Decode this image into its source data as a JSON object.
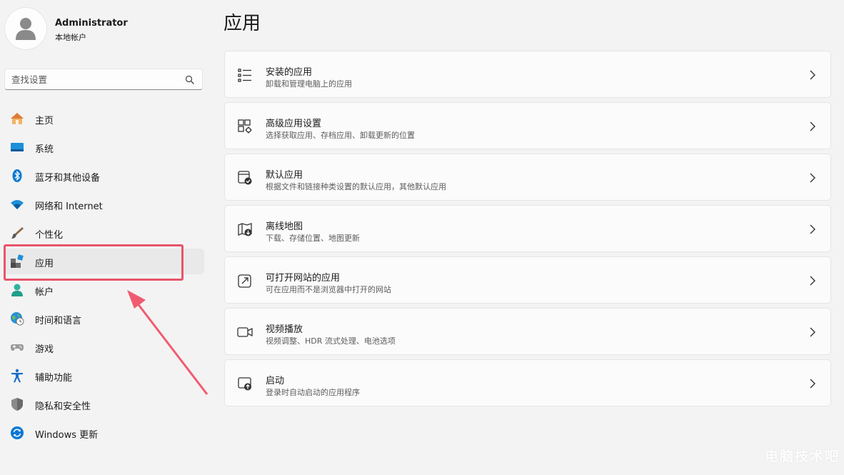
{
  "user": {
    "name": "Administrator",
    "account_type": "本地帐户"
  },
  "search": {
    "placeholder": "查找设置",
    "value": ""
  },
  "sidebar": {
    "items": [
      {
        "label": "主页",
        "icon": "home-icon"
      },
      {
        "label": "系统",
        "icon": "system-icon"
      },
      {
        "label": "蓝牙和其他设备",
        "icon": "bluetooth-icon"
      },
      {
        "label": "网络和 Internet",
        "icon": "wifi-icon"
      },
      {
        "label": "个性化",
        "icon": "brush-icon"
      },
      {
        "label": "应用",
        "icon": "apps-icon",
        "active": true
      },
      {
        "label": "帐户",
        "icon": "account-icon"
      },
      {
        "label": "时间和语言",
        "icon": "globe-clock-icon"
      },
      {
        "label": "游戏",
        "icon": "gamepad-icon"
      },
      {
        "label": "辅助功能",
        "icon": "accessibility-icon"
      },
      {
        "label": "隐私和安全性",
        "icon": "shield-icon"
      },
      {
        "label": "Windows 更新",
        "icon": "update-icon"
      }
    ]
  },
  "main": {
    "title": "应用",
    "cards": [
      {
        "title": "安装的应用",
        "subtitle": "卸载和管理电脑上的应用",
        "icon": "list-icon"
      },
      {
        "title": "高级应用设置",
        "subtitle": "选择获取应用、存档应用、卸载更新的位置",
        "icon": "app-settings-icon"
      },
      {
        "title": "默认应用",
        "subtitle": "根据文件和链接种类设置的默认应用，其他默认应用",
        "icon": "default-apps-icon"
      },
      {
        "title": "离线地图",
        "subtitle": "下载、存储位置、地图更新",
        "icon": "offline-map-icon"
      },
      {
        "title": "可打开网站的应用",
        "subtitle": "可在应用而不是浏览器中打开的网站",
        "icon": "open-link-icon"
      },
      {
        "title": "视频播放",
        "subtitle": "视频调整、HDR 流式处理、电池选项",
        "icon": "video-icon"
      },
      {
        "title": "启动",
        "subtitle": "登录时自动启动的应用程序",
        "icon": "startup-icon"
      }
    ]
  },
  "watermark": "电脑技术吧",
  "colors": {
    "annotation": "#e8546a",
    "accent": "#0067c0",
    "background": "#f3f3f3"
  }
}
